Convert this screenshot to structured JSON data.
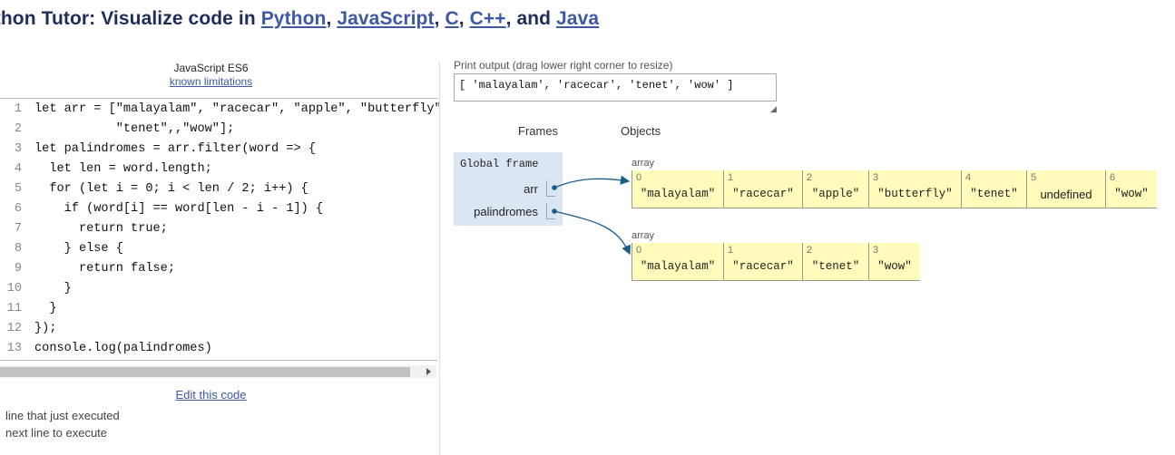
{
  "header": {
    "prefix": "ython Tutor: Visualize code in ",
    "langs": [
      "Python",
      "JavaScript",
      "C",
      "C++",
      "Java"
    ],
    "sep1": ", ",
    "sep2": ", ",
    "sep3": ", ",
    "sep4": ", and "
  },
  "editor": {
    "language": "JavaScript ES6",
    "limits_link": "known limitations",
    "lines": [
      {
        "n": "1",
        "text": "let arr = [\"malayalam\", \"racecar\", \"apple\", \"butterfly\""
      },
      {
        "n": "2",
        "text": "           \"tenet\",,\"wow\"];"
      },
      {
        "n": "3",
        "text": "let palindromes = arr.filter(word => {"
      },
      {
        "n": "4",
        "text": "  let len = word.length;"
      },
      {
        "n": "5",
        "text": "  for (let i = 0; i < len / 2; i++) {"
      },
      {
        "n": "6",
        "text": "    if (word[i] == word[len - i - 1]) {"
      },
      {
        "n": "7",
        "text": "      return true;"
      },
      {
        "n": "8",
        "text": "    } else {"
      },
      {
        "n": "9",
        "text": "      return false;"
      },
      {
        "n": "10",
        "text": "    }"
      },
      {
        "n": "11",
        "text": "  }"
      },
      {
        "n": "12",
        "text": "});"
      },
      {
        "n": "13",
        "text": "console.log(palindromes)"
      }
    ],
    "edit_link": "Edit this code",
    "legend_executed": "line that just executed",
    "legend_next": "next line to execute",
    "colors": {
      "executed_marker": "#a0a0a0",
      "accent": "#3d58a5"
    }
  },
  "output": {
    "label": "Print output (drag lower right corner to resize)",
    "text": "[ 'malayalam', 'racecar', 'tenet', 'wow' ]"
  },
  "viz": {
    "frames_header": "Frames",
    "objects_header": "Objects",
    "global_frame": "Global frame",
    "vars": [
      "arr",
      "palindromes"
    ],
    "array_label": "array",
    "array1": [
      {
        "i": "0",
        "v": "\"malayalam\""
      },
      {
        "i": "1",
        "v": "\"racecar\""
      },
      {
        "i": "2",
        "v": "\"apple\""
      },
      {
        "i": "3",
        "v": "\"butterfly\""
      },
      {
        "i": "4",
        "v": "\"tenet\""
      },
      {
        "i": "5",
        "v": "undefined"
      },
      {
        "i": "6",
        "v": "\"wow\""
      }
    ],
    "array2": [
      {
        "i": "0",
        "v": "\"malayalam\""
      },
      {
        "i": "1",
        "v": "\"racecar\""
      },
      {
        "i": "2",
        "v": "\"tenet\""
      },
      {
        "i": "3",
        "v": "\"wow\""
      }
    ],
    "colors": {
      "frame_bg": "#dbe6f3",
      "heap_bg": "#fffbbb",
      "pointer": "#1a5a8a"
    }
  }
}
